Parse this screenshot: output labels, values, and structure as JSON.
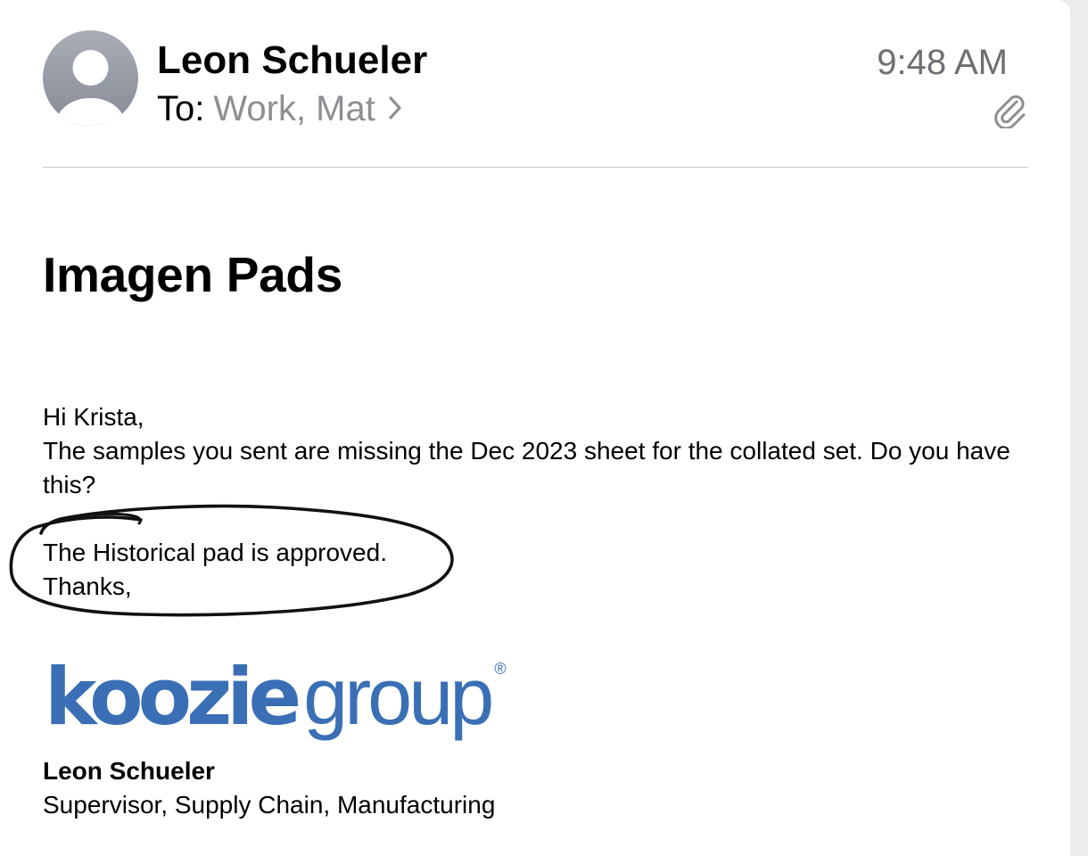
{
  "header": {
    "sender": "Leon Schueler",
    "to_label": "To:",
    "recipients": "Work, Mat",
    "time": "9:48 AM",
    "chevron_icon": "chevron-right-icon",
    "attachment_icon": "paperclip-icon",
    "avatar_icon": "person-avatar-icon"
  },
  "subject": "Imagen Pads",
  "body": {
    "greeting": "Hi Krista,",
    "line1": "The samples you sent are missing the Dec 2023 sheet for the collated set.  Do you have this?",
    "line2": "The Historical pad is approved.",
    "line3": "Thanks,"
  },
  "logo": {
    "part1": "koozie",
    "part2": "group",
    "mark": "®",
    "color": "#3a6fb5"
  },
  "signature": {
    "name": "Leon Schueler",
    "title": "Supervisor, Supply Chain, Manufacturing"
  },
  "colors": {
    "secondary_text": "#8e8e93",
    "time_text": "#6e6e73",
    "brand": "#3a6fb5"
  }
}
